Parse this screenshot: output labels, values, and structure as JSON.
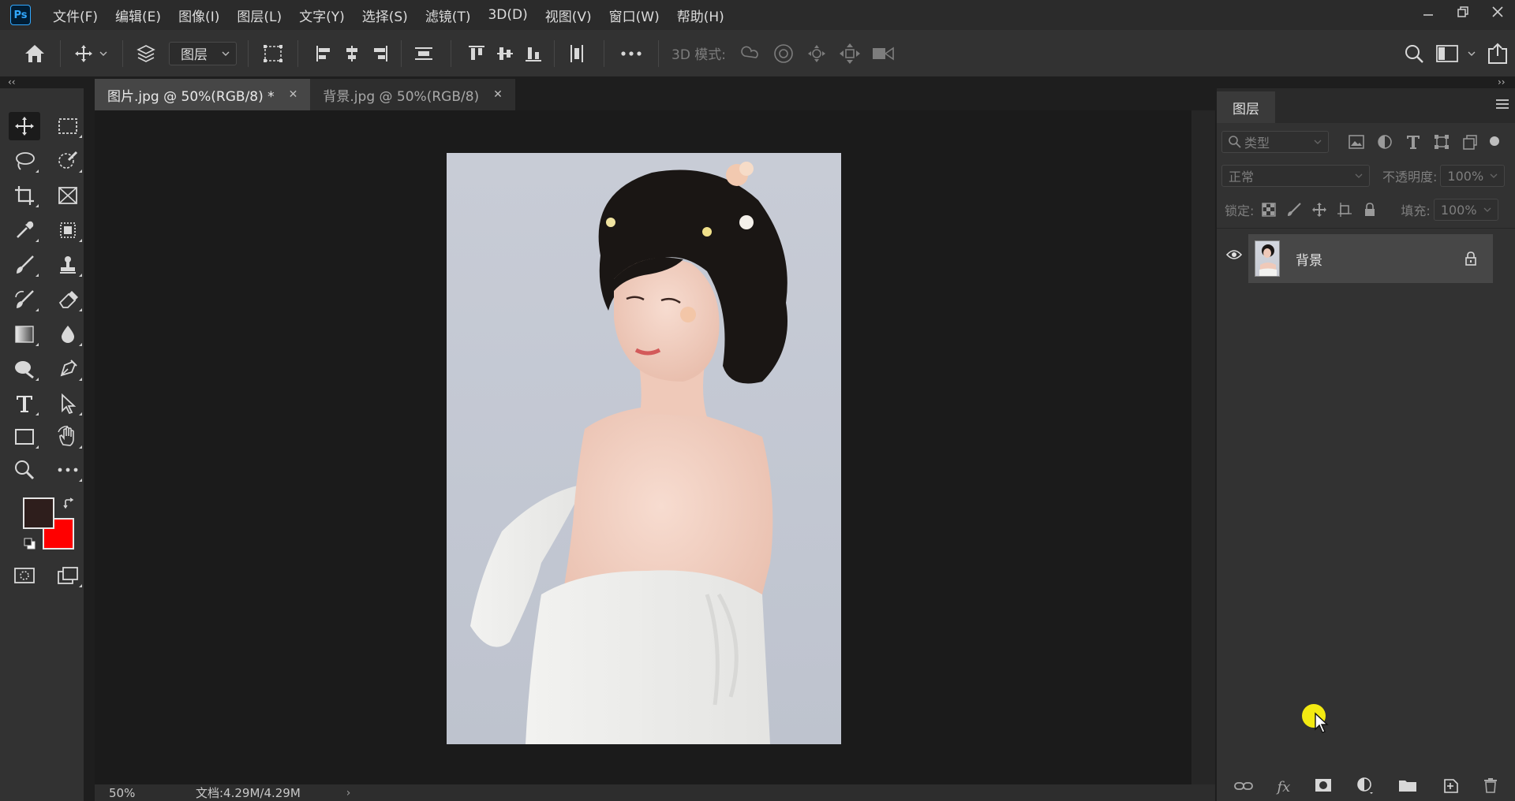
{
  "app": {
    "logo": "Ps",
    "menu": [
      "文件(F)",
      "编辑(E)",
      "图像(I)",
      "图层(L)",
      "文字(Y)",
      "选择(S)",
      "滤镜(T)",
      "3D(D)",
      "视图(V)",
      "窗口(W)",
      "帮助(H)"
    ],
    "window_controls": [
      "minimize-icon",
      "restore-icon",
      "close-icon"
    ]
  },
  "options_bar": {
    "auto_select_target": "图层",
    "mode_3d_label": "3D 模式:"
  },
  "tabs": [
    {
      "label": "图片.jpg @ 50%(RGB/8) *",
      "active": true
    },
    {
      "label": "背景.jpg @ 50%(RGB/8)",
      "active": false
    }
  ],
  "status": {
    "zoom": "50%",
    "doc_info": "文档:4.29M/4.29M"
  },
  "colors": {
    "foreground": "#2e1e1c",
    "background": "#ff0000",
    "accent": "#31a8ff"
  },
  "layers_panel": {
    "tab": "图层",
    "filter_placeholder": "类型",
    "blend_mode": "正常",
    "opacity_label": "不透明度:",
    "opacity_value": "100%",
    "lock_label": "锁定:",
    "fill_label": "填充:",
    "fill_value": "100%",
    "layers": [
      {
        "name": "背景",
        "visible": true,
        "locked": true
      }
    ]
  }
}
